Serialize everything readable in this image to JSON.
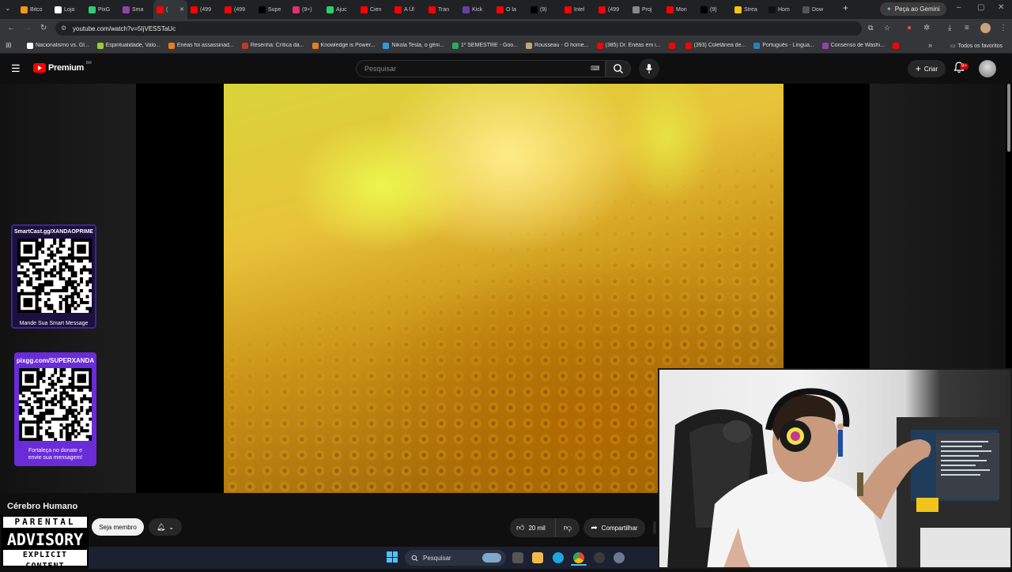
{
  "browser": {
    "tabs": [
      {
        "label": "Bitco",
        "fav": "#f7931a"
      },
      {
        "label": "Loja",
        "fav": "#ffffff"
      },
      {
        "label": "PixG",
        "fav": "#2ecc71"
      },
      {
        "label": "Sma",
        "fav": "#8e44ad"
      },
      {
        "label": "(",
        "fav": "#ff0000",
        "active": true
      },
      {
        "label": "(499",
        "fav": "#ff0000"
      },
      {
        "label": "(499",
        "fav": "#ff0000"
      },
      {
        "label": "Supe",
        "fav": "#000000"
      },
      {
        "label": "(9+)",
        "fav": "#e1306c"
      },
      {
        "label": "Ajuc",
        "fav": "#25d366"
      },
      {
        "label": "Cien",
        "fav": "#ff0000"
      },
      {
        "label": "A Úl",
        "fav": "#ff0000"
      },
      {
        "label": "Tran",
        "fav": "#ff0000"
      },
      {
        "label": "Kick",
        "fav": "#6441a5"
      },
      {
        "label": "O la",
        "fav": "#ff0000"
      },
      {
        "label": "(9)",
        "fav": "#000000"
      },
      {
        "label": "Intel",
        "fav": "#ff0000"
      },
      {
        "label": "(499",
        "fav": "#ff0000"
      },
      {
        "label": "Proj",
        "fav": "#888888"
      },
      {
        "label": "Mon",
        "fav": "#ff0000"
      },
      {
        "label": "(9)",
        "fav": "#000000"
      },
      {
        "label": "Strea",
        "fav": "#f1c40f"
      },
      {
        "label": "Hom",
        "fav": "#111111"
      },
      {
        "label": "Dow",
        "fav": "#555555"
      }
    ],
    "new_tab_label": "+",
    "gemini_label": "Peça ao Gemini",
    "url": "youtube.com/watch?v=5IjVESSTaUc",
    "bookmarks": [
      {
        "label": "Nacionalismo vs. Gl...",
        "fav": "#ffffff"
      },
      {
        "label": "Espiritualidade, Valo...",
        "fav": "#9acd32"
      },
      {
        "label": "Enéas foi assassinad...",
        "fav": "#e67e22"
      },
      {
        "label": "Resenha: Crítica da...",
        "fav": "#c0392b"
      },
      {
        "label": "Knowledge is Power...",
        "fav": "#e67e22"
      },
      {
        "label": "Nikola Tesla, o gêni...",
        "fav": "#3498db"
      },
      {
        "label": "1º SEMESTRE - Goo...",
        "fav": "#27ae60"
      },
      {
        "label": "Rousseau - O home...",
        "fav": "#bdaa7c"
      },
      {
        "label": "(385) Dr. Enéas em i...",
        "fav": "#ff0000"
      },
      {
        "label": "",
        "fav": "#ff0000"
      },
      {
        "label": "(393) Coletânea de...",
        "fav": "#ff0000"
      },
      {
        "label": "Português - Língua...",
        "fav": "#2980b9"
      },
      {
        "label": "Consenso de Washi...",
        "fav": "#8e44ad"
      },
      {
        "label": "",
        "fav": "#ff0000"
      }
    ],
    "all_bookmarks_label": "Todos os favoritos"
  },
  "youtube": {
    "logo_text": "Premium",
    "country_code": "BR",
    "search_placeholder": "Pesquisar",
    "create_label": "Criar",
    "notif_count": "9+",
    "channel_title": "Cérebro Humano",
    "member_label": "Seja membro",
    "like_count": "20 mil",
    "share_label": "Compartilhar"
  },
  "overlay": {
    "qr1_title": "SmartCast.gg/XANDAOPRIME",
    "qr1_footer": "Mande Sua Smart Message",
    "qr2_title": "pixgg.com/SUPERXANDA",
    "qr2_footer_line1": "Fortaleça no donate e",
    "qr2_footer_line2": "envie sua mensagem!",
    "advisory_line1": "PARENTAL",
    "advisory_line2": "ADVISORY",
    "advisory_line3": "EXPLICIT CONTENT"
  },
  "taskbar": {
    "search_label": "Pesquisar"
  },
  "colors": {
    "youtube_red": "#ff0000",
    "qr_purple": "#6a2bd9",
    "page_bg": "#0f0f0f"
  }
}
